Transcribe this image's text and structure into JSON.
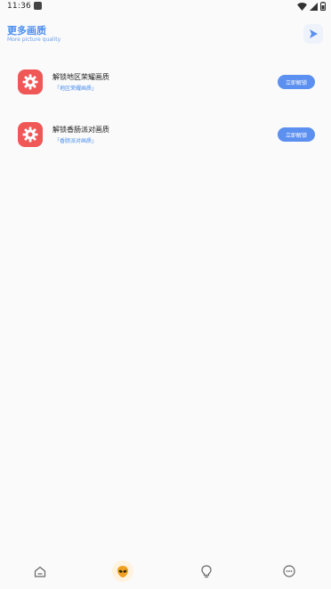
{
  "status_bar": {
    "time": "11:36"
  },
  "header": {
    "title": "更多画质",
    "subtitle": "More picture quality"
  },
  "items": [
    {
      "title": "解锁地区荣耀画质",
      "subtitle": "「地区荣耀画质」",
      "button_label": "立即解锁"
    },
    {
      "title": "解锁香肠派对画质",
      "subtitle": "「香肠派对画质」",
      "button_label": "立即解锁"
    }
  ],
  "bottom_nav": {
    "items": [
      {
        "icon": "home-icon"
      },
      {
        "icon": "alien-icon",
        "active": true
      },
      {
        "icon": "lightbulb-icon"
      },
      {
        "icon": "more-icon"
      }
    ]
  },
  "colors": {
    "accent": "#4a8ef0",
    "button": "#5b8ff0",
    "app_icon": "#f05757",
    "nav_active": "#f0a020"
  }
}
